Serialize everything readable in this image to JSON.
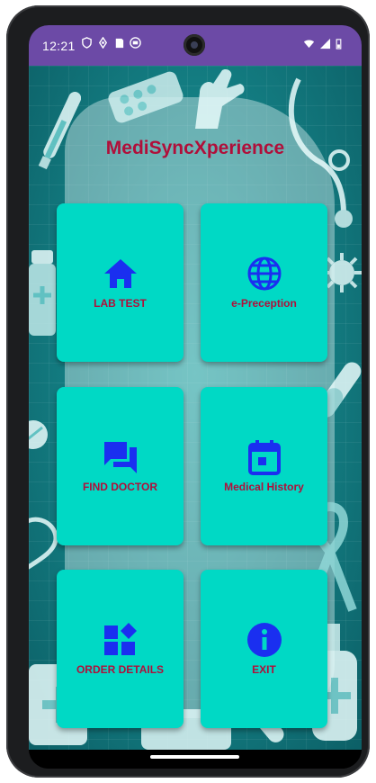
{
  "status_bar": {
    "time": "12:21",
    "icons_left": [
      "shield-icon",
      "location-arrow-icon",
      "sd-card-icon",
      "android-icon"
    ],
    "icons_right": [
      "wifi-icon",
      "signal-icon",
      "battery-icon"
    ]
  },
  "app": {
    "title": "MediSyncXperience",
    "title_color": "#b00f3a",
    "card_color": "#00d9c5",
    "icon_color": "#1a2ff0"
  },
  "menu": [
    {
      "label": "LAB TEST",
      "icon": "home-icon"
    },
    {
      "label": "e-Preception",
      "icon": "globe-icon"
    },
    {
      "label": "FIND DOCTOR",
      "icon": "chat-icon"
    },
    {
      "label": "Medical History",
      "icon": "calendar-icon"
    },
    {
      "label": "ORDER DETAILS",
      "icon": "widgets-icon"
    },
    {
      "label": "EXIT",
      "icon": "info-icon"
    }
  ]
}
